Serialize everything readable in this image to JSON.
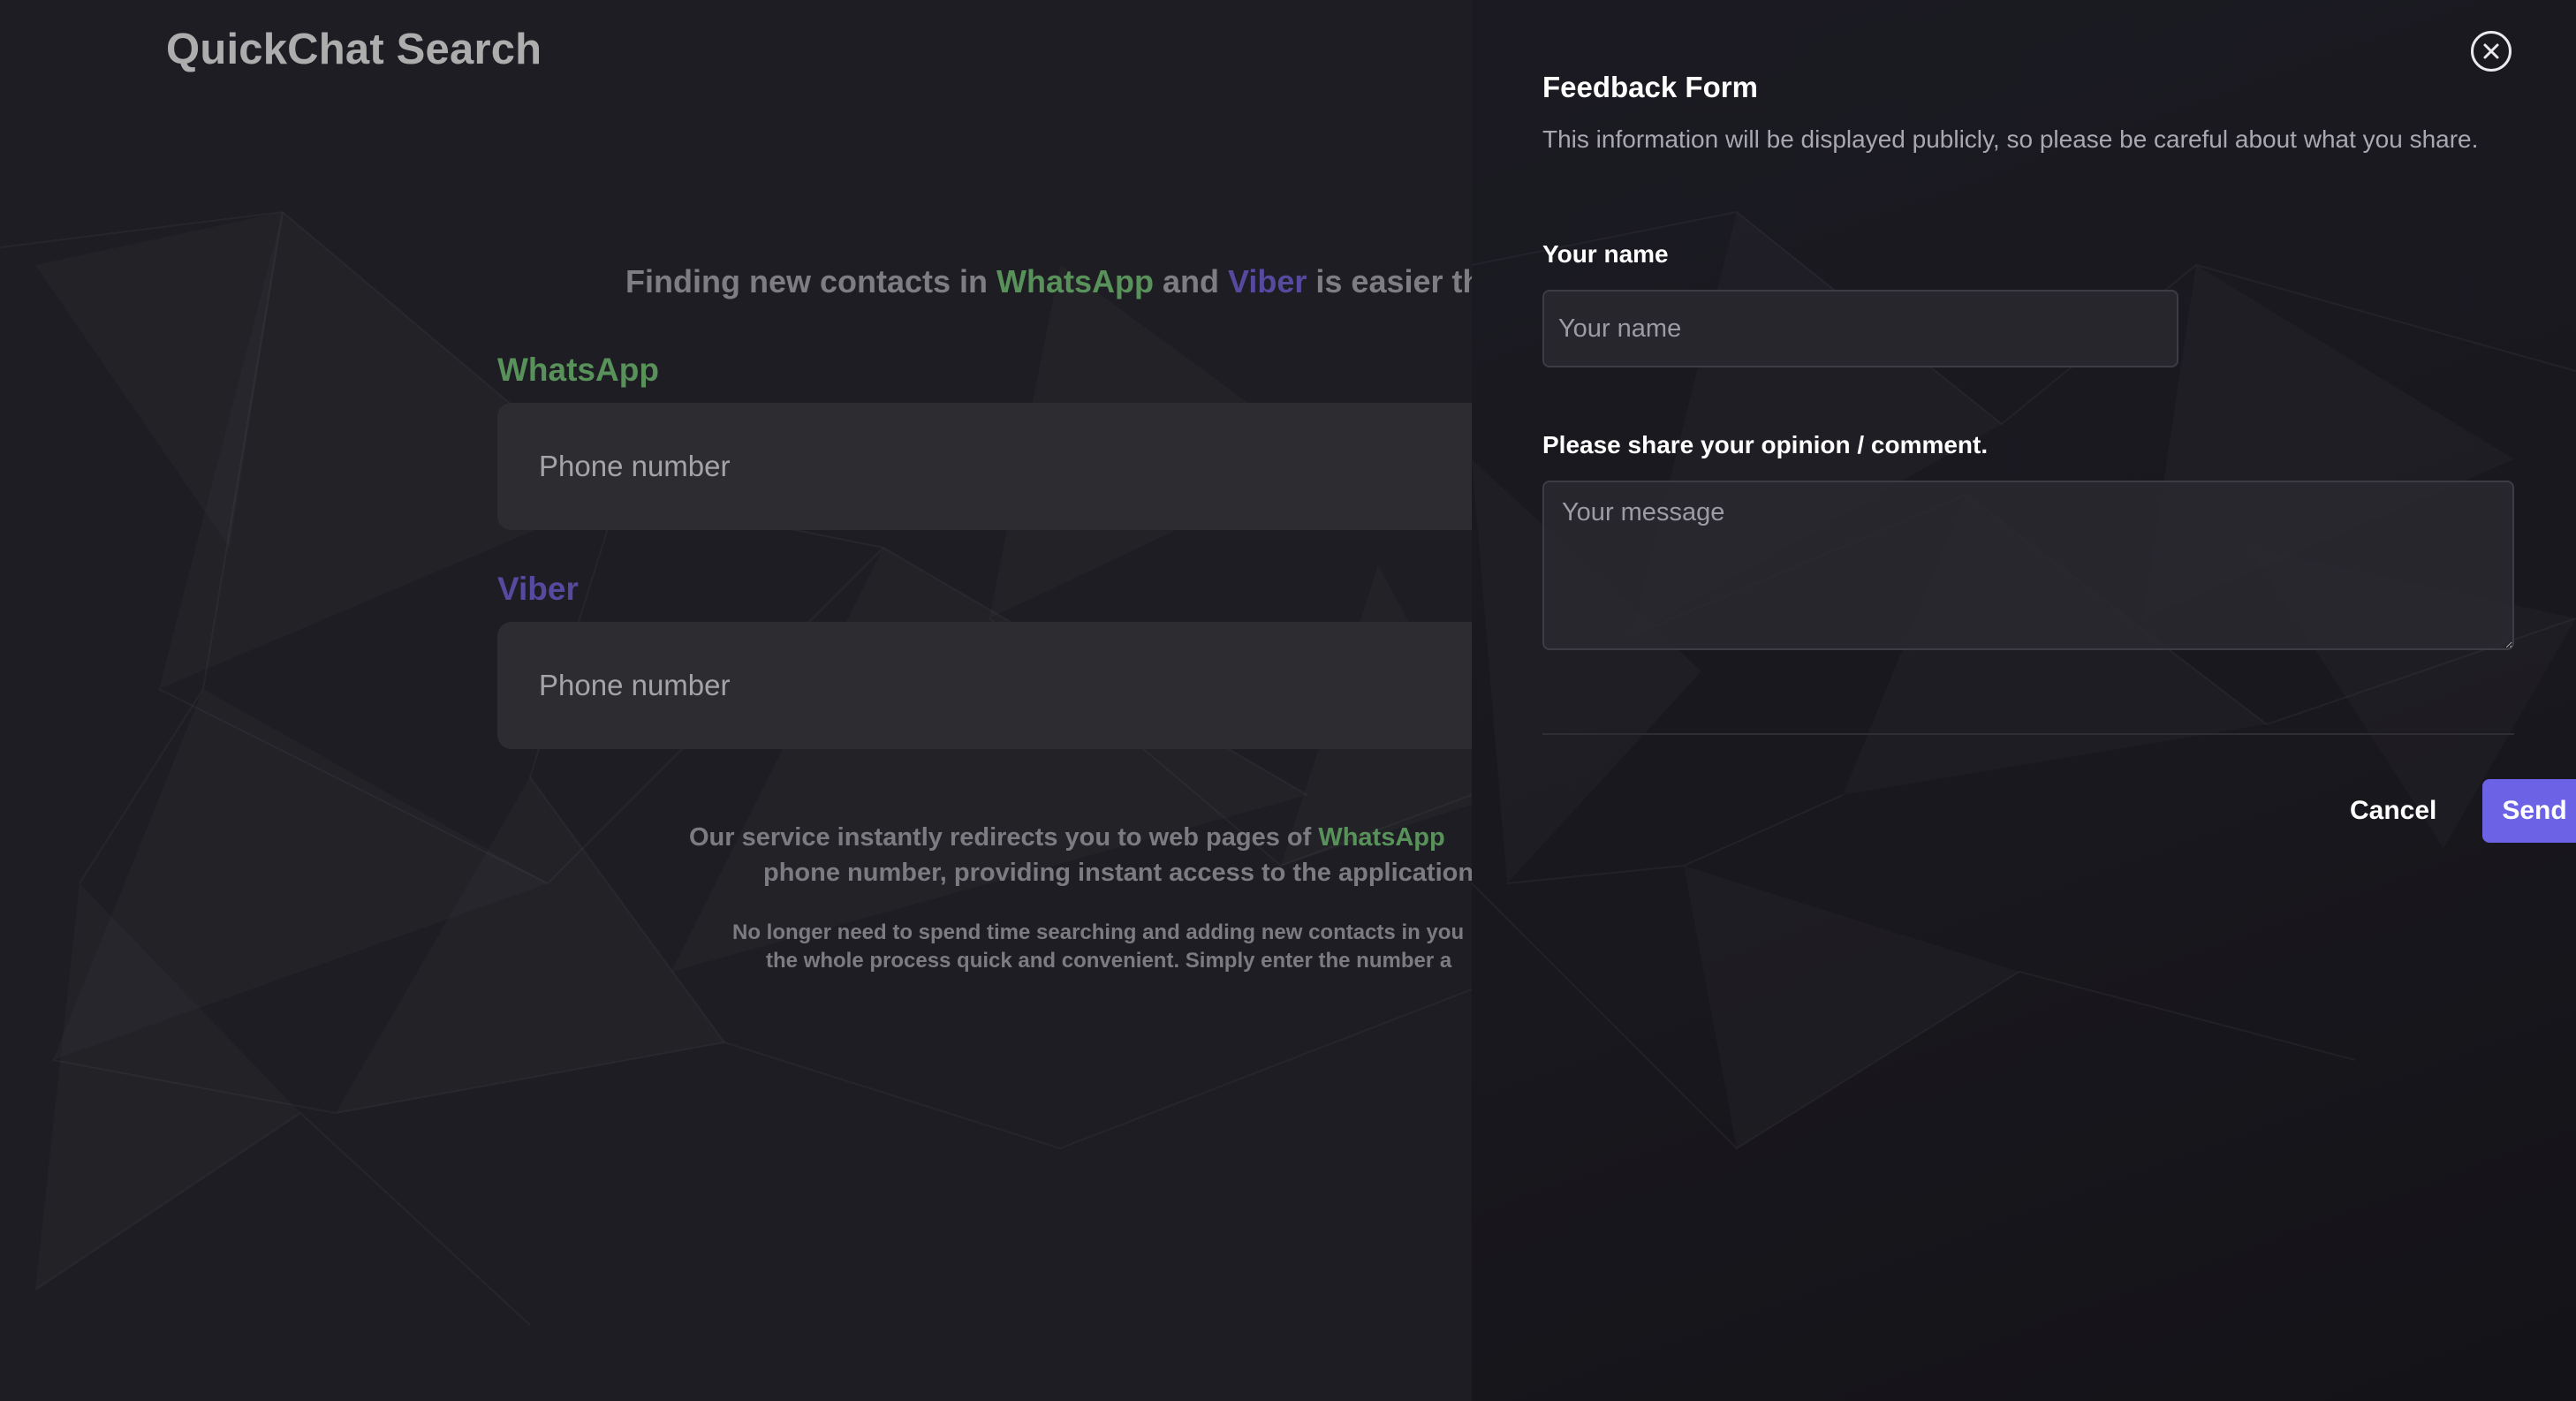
{
  "app": {
    "title": "QuickChat Search"
  },
  "hero": {
    "text_before": "Finding new contacts in ",
    "whatsapp": "WhatsApp",
    "and": " and ",
    "viber": "Viber",
    "text_after": " is easier th"
  },
  "whatsapp_section": {
    "label": "WhatsApp",
    "placeholder": "Phone number"
  },
  "viber_section": {
    "label": "Viber",
    "placeholder": "Phone number"
  },
  "description": {
    "line1_before": "Our service instantly redirects you to web pages of ",
    "line1_whatsapp": "WhatsApp",
    "line2": "phone number, providing instant access to the applications",
    "small_line1": "No longer need to spend time searching and adding new contacts in you",
    "small_line2": "the whole process quick and convenient. Simply enter the number a"
  },
  "feedback": {
    "title": "Feedback Form",
    "subtitle": "This information will be displayed publicly, so please be careful about what you share.",
    "name_label": "Your name",
    "name_placeholder": "Your name",
    "message_label": "Please share your opinion / comment.",
    "message_placeholder": "Your message",
    "cancel_label": "Cancel",
    "send_label": "Send",
    "close_icon": "close-circle-icon"
  },
  "colors": {
    "whatsapp": "#7dd67f",
    "viber": "#7a67ea",
    "send_button": "#6b62e6"
  }
}
